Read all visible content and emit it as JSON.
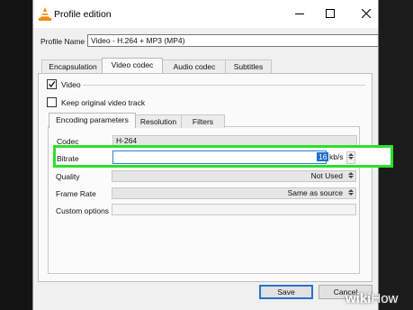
{
  "window": {
    "title": "Profile edition",
    "icon": "vlc-cone-icon",
    "controls": [
      "minimize-icon",
      "maximize-icon",
      "close-icon"
    ]
  },
  "profile": {
    "label": "Profile Name",
    "value": "Video - H.264 + MP3 (MP4)"
  },
  "tabs": [
    {
      "label": "Encapsulation",
      "active": false
    },
    {
      "label": "Video codec",
      "active": true
    },
    {
      "label": "Audio codec",
      "active": false
    },
    {
      "label": "Subtitles",
      "active": false
    }
  ],
  "video": {
    "checkbox_label": "Video",
    "checked": true,
    "keep_original_label": "Keep original video track",
    "keep_original_checked": false
  },
  "subtabs": [
    {
      "label": "Encoding parameters",
      "active": true
    },
    {
      "label": "Resolution",
      "active": false
    },
    {
      "label": "Filters",
      "active": false
    }
  ],
  "fields": {
    "codec": {
      "label": "Codec",
      "value": "H-264"
    },
    "bitrate": {
      "label": "Bitrate",
      "value": "16",
      "unit": "kb/s"
    },
    "quality": {
      "label": "Quality",
      "value": "Not Used"
    },
    "frame_rate": {
      "label": "Frame Rate",
      "value": "Same as source"
    },
    "custom_options": {
      "label": "Custom options",
      "value": ""
    }
  },
  "buttons": {
    "save": "Save",
    "cancel": "Cancel"
  },
  "watermark": {
    "part1": "wiki",
    "part2": "How"
  },
  "colors": {
    "highlight": "#2be02b",
    "selection": "#1e6ecd",
    "default_button_border": "#2a73c9"
  }
}
